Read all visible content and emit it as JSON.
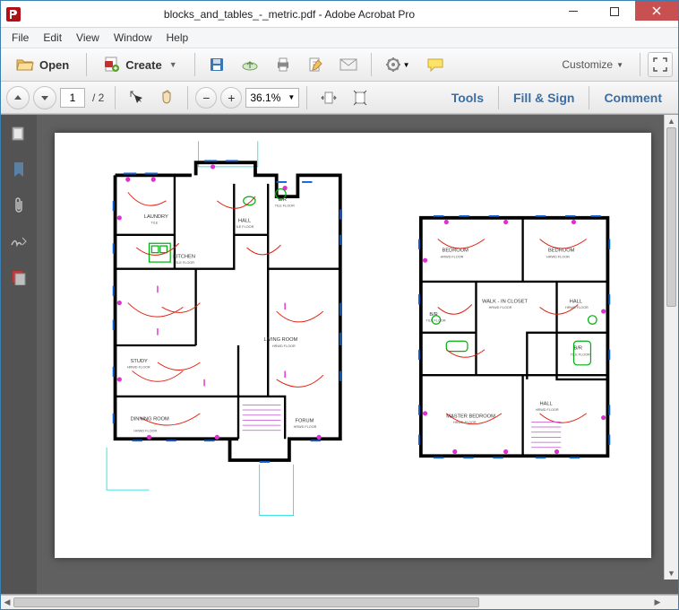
{
  "window": {
    "title": "blocks_and_tables_-_metric.pdf - Adobe Acrobat Pro"
  },
  "menubar": {
    "file": "File",
    "edit": "Edit",
    "view": "View",
    "window": "Window",
    "help": "Help"
  },
  "toolbar": {
    "open": "Open",
    "create": "Create",
    "customize": "Customize"
  },
  "nav": {
    "page_current": "1",
    "page_total": "/ 2",
    "zoom": "36.1%"
  },
  "panels": {
    "tools": "Tools",
    "fill_sign": "Fill & Sign",
    "comment": "Comment"
  },
  "floorplan": {
    "left": {
      "laundry": "LAUNDRY",
      "laundry_sub": "TILE",
      "hall": "HALL",
      "hall_sub": "TILE FLOOR",
      "br": "B/R",
      "br_sub": "TILE FLOOR",
      "kitchen": "KITCHEN",
      "kitchen_sub": "TILE FLOOR",
      "study": "STUDY",
      "study_sub": "HRWD FLOOR",
      "living": "LIVING ROOM",
      "living_sub": "HRWD FLOOR",
      "dinning": "DINNING ROOM",
      "dinning_sub": "HRWD FLOOR",
      "forum": "FORUM",
      "forum_sub": "HRWD FLOOR"
    },
    "right": {
      "bedroom1": "BEDROOM",
      "bedroom1_sub": "HRWD FLOOR",
      "bedroom2": "BEDROOM",
      "bedroom2_sub": "HRWD FLOOR",
      "br1": "B/R",
      "br1_sub": "TILE FLOOR",
      "closet": "WALK - IN CLOSET",
      "closet_sub": "HRWD FLOOR",
      "hall": "HALL",
      "hall_sub": "HRWD FLOOR",
      "br2": "B/R",
      "br2_sub": "TILE FLOOR",
      "master": "MASTER BEDROOM",
      "master_sub": "HRWD FLOOR",
      "hall2": "HALL",
      "hall2_sub": "HRWD FLOOR"
    }
  }
}
